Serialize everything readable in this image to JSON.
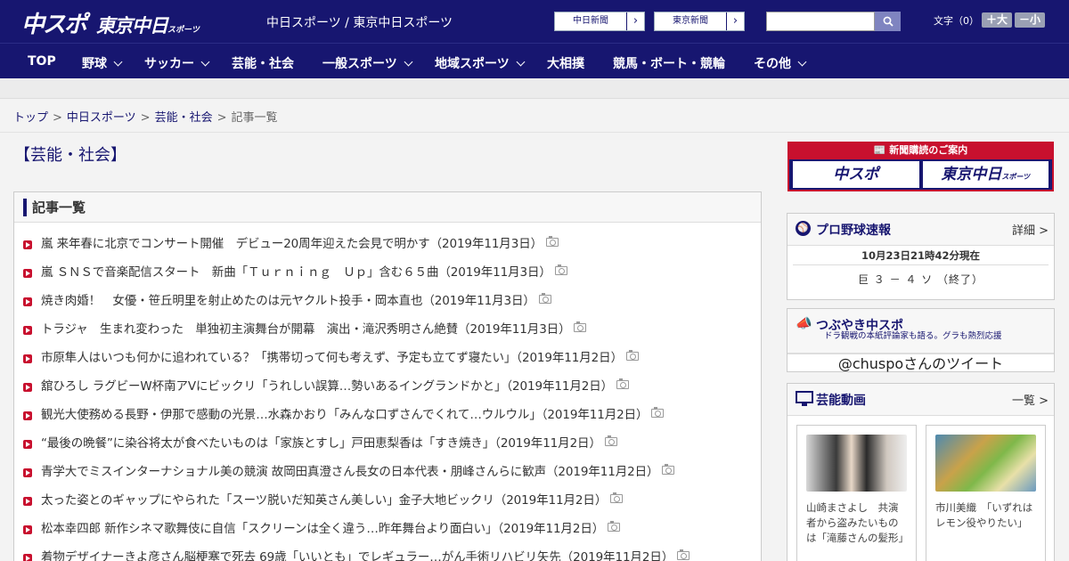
{
  "header": {
    "logo_main": "中スポ",
    "logo_sub": "東京中日",
    "logo_sub_small": "スポーツ",
    "site_links": "中日スポーツ / 東京中日スポーツ",
    "paper_buttons": [
      "中日新聞",
      "東京新聞"
    ],
    "search_placeholder": "",
    "font_label": "文字（0）",
    "font_bigger": "＋大",
    "font_smaller": "－小"
  },
  "nav": {
    "items": [
      {
        "label": "TOP",
        "dropdown": false
      },
      {
        "label": "野球",
        "dropdown": true
      },
      {
        "label": "サッカー",
        "dropdown": true
      },
      {
        "label": "芸能・社会",
        "dropdown": false
      },
      {
        "label": "一般スポーツ",
        "dropdown": true
      },
      {
        "label": "地域スポーツ",
        "dropdown": true
      },
      {
        "label": "大相撲",
        "dropdown": false
      },
      {
        "label": "競馬・ボート・競輪",
        "dropdown": false
      },
      {
        "label": "その他",
        "dropdown": true
      }
    ]
  },
  "breadcrumb": {
    "items": [
      "トップ",
      "中日スポーツ",
      "芸能・社会"
    ],
    "current": "記事一覧",
    "separator": ">"
  },
  "page": {
    "category_title": "【芸能・社会】",
    "list_heading": "記事一覧"
  },
  "articles": [
    "嵐 来年春に北京でコンサート開催　デビュー20周年迎えた会見で明かす（2019年11月3日）",
    "嵐 ＳＮＳで音楽配信スタート　新曲「Ｔｕｒｎｉｎｇ　Ｕｐ」含む６５曲（2019年11月3日）",
    "焼き肉婚！　女優・笹丘明里を射止めたのは元ヤクルト投手・岡本直也（2019年11月3日）",
    "トラジャ　生まれ変わった　単独初主演舞台が開幕　演出・滝沢秀明さん絶賛（2019年11月3日）",
    "市原隼人はいつも何かに追われている？「携帯切って何も考えず、予定も立てず寝たい」（2019年11月2日）",
    "舘ひろし ラグビーW杯南アVにビックリ「うれしい誤算…勢いあるイングランドかと」（2019年11月2日）",
    "観光大使務める長野・伊那で感動の光景…水森かおり「みんな口ずさんでくれて…ウルウル」（2019年11月2日）",
    "“最後の晩餐”に染谷将太が食べたいものは「家族とすし」戸田恵梨香は「すき焼き」（2019年11月2日）",
    "青学大でミスインターナショナル美の競演 故岡田真澄さん長女の日本代表・朋峰さんらに歓声（2019年11月2日）",
    "太った姿とのギャップにやられた「スーツ脱いだ知英さん美しい」金子大地ビックリ（2019年11月2日）",
    "松本幸四郎 新作シネマ歌舞伎に自信「スクリーンは全く違う…昨年舞台より面白い」（2019年11月2日）",
    "着物デザイナーきよ彦さん脳梗塞で死去 69歳「いいとも」でレギュラー…がん手術リハビリ矢先（2019年11月2日）"
  ],
  "sidebar": {
    "subscribe_title": "新聞購読のご案内",
    "subscribe_logo1": "中スポ",
    "subscribe_logo2": "東京中日",
    "subscribe_logo2_small": "スポーツ",
    "baseball": {
      "title": "プロ野球速報",
      "more": "詳細 >",
      "time": "10月23日21時42分現在",
      "score": "巨 ３ － ４ ソ （終了）"
    },
    "tweet": {
      "title": "つぶやき中スポ",
      "subtitle": "ドラ観戦の本紙評論家も語る。グラも熱烈応援",
      "handle": "@chuspoさんのツイート"
    },
    "video": {
      "title": "芸能動画",
      "more": "一覧 >",
      "items": [
        "山崎まさよし　共演者から盗みたいものは「滝藤さんの髪形」",
        "市川美織　「いずれはレモン役やりたい」"
      ]
    }
  },
  "colors": {
    "navy": "#171670",
    "red": "#c8102e"
  }
}
